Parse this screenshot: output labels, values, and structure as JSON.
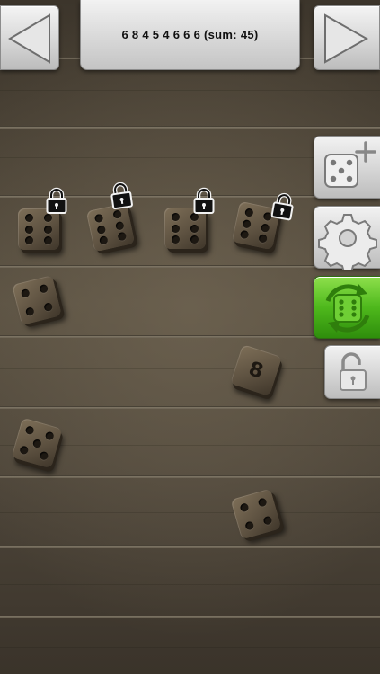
{
  "status": {
    "text": "6 8 4 5 4 6 6 6 (sum: 45)"
  },
  "nav": {
    "prev": "prev-arrow-icon",
    "next": "next-arrow-icon"
  },
  "toolbar": {
    "add_die": "add-die-icon",
    "settings": "gear-icon",
    "roll": "roll-dice-icon",
    "unlock_all": "unlock-icon"
  },
  "colors": {
    "roll_green": "#4eb81c",
    "wood": "#5a5142",
    "pip": "#1d1812"
  },
  "dice": [
    {
      "value": 6,
      "locked": true
    },
    {
      "value": 6,
      "locked": true
    },
    {
      "value": 6,
      "locked": true
    },
    {
      "value": 6,
      "locked": true
    },
    {
      "value": 4,
      "locked": false
    },
    {
      "value": 8,
      "locked": false
    },
    {
      "value": 5,
      "locked": false
    },
    {
      "value": 4,
      "locked": false
    }
  ]
}
